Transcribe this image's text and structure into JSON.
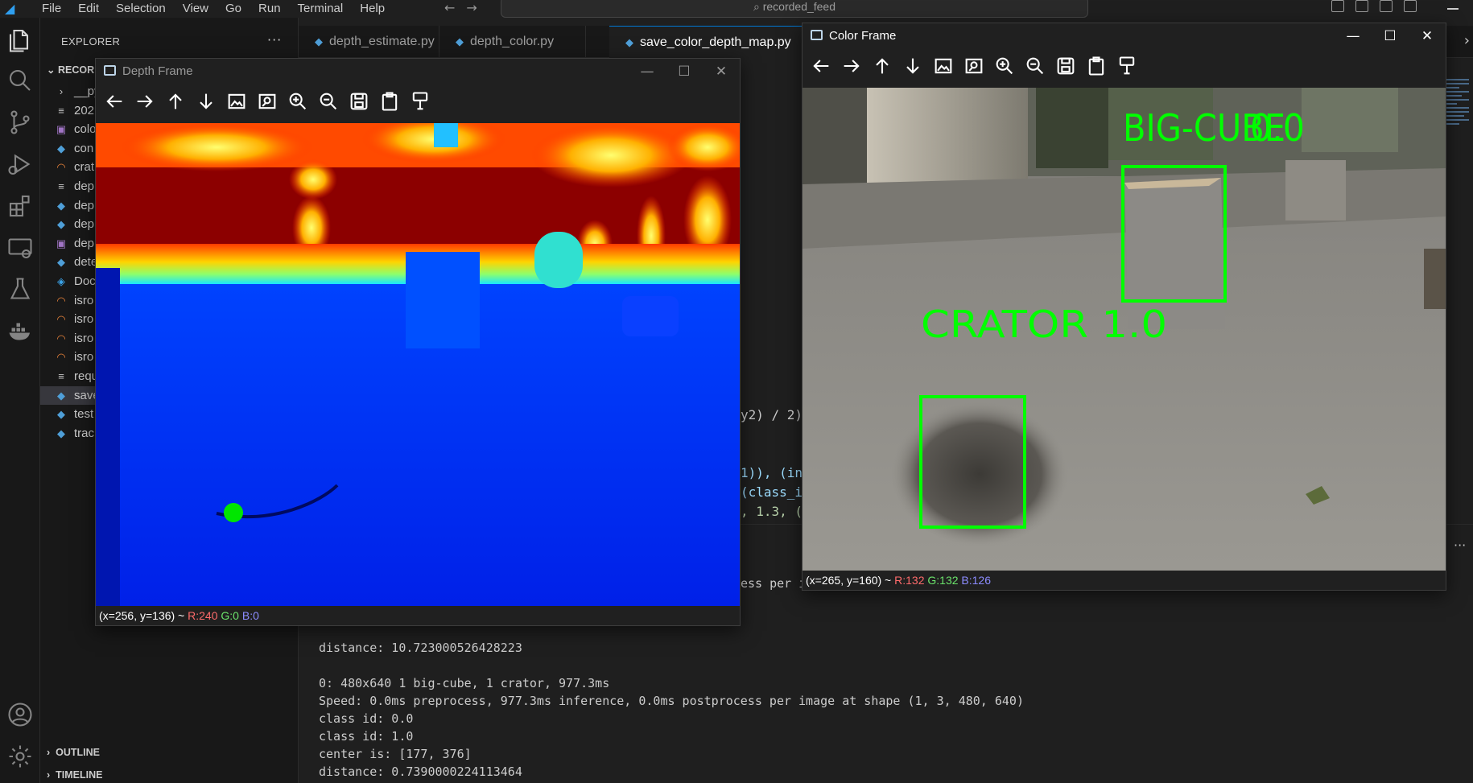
{
  "menu": [
    "File",
    "Edit",
    "Selection",
    "View",
    "Go",
    "Run",
    "Terminal",
    "Help"
  ],
  "search": {
    "text": "recorded_feed"
  },
  "sidebar": {
    "title": "EXPLORER",
    "root_label": "RECOR",
    "items": [
      {
        "icon": "chevron-right-icon",
        "glyph": "›",
        "kind": "ic-chev",
        "label": "__py"
      },
      {
        "icon": "list-icon",
        "glyph": "≡",
        "kind": "ic-list",
        "label": "202"
      },
      {
        "icon": "image-file-icon",
        "glyph": "▣",
        "kind": "ic-img",
        "label": "colo"
      },
      {
        "icon": "python-file-icon",
        "glyph": "◆",
        "kind": "ic-py",
        "label": "con"
      },
      {
        "icon": "rss-file-icon",
        "glyph": "◠",
        "kind": "ic-rss",
        "label": "crat"
      },
      {
        "icon": "list-icon",
        "glyph": "≡",
        "kind": "ic-list",
        "label": "dep"
      },
      {
        "icon": "python-file-icon",
        "glyph": "◆",
        "kind": "ic-py",
        "label": "dep"
      },
      {
        "icon": "python-file-icon",
        "glyph": "◆",
        "kind": "ic-py",
        "label": "dep"
      },
      {
        "icon": "image-file-icon",
        "glyph": "▣",
        "kind": "ic-img",
        "label": "dep"
      },
      {
        "icon": "python-file-icon",
        "glyph": "◆",
        "kind": "ic-py",
        "label": "dete"
      },
      {
        "icon": "docker-icon",
        "glyph": "◈",
        "kind": "ic-docker",
        "label": "Doc"
      },
      {
        "icon": "rss-file-icon",
        "glyph": "◠",
        "kind": "ic-rss",
        "label": "isro"
      },
      {
        "icon": "rss-file-icon",
        "glyph": "◠",
        "kind": "ic-rss",
        "label": "isro"
      },
      {
        "icon": "rss-file-icon",
        "glyph": "◠",
        "kind": "ic-rss",
        "label": "isro"
      },
      {
        "icon": "rss-file-icon",
        "glyph": "◠",
        "kind": "ic-rss",
        "label": "isro"
      },
      {
        "icon": "list-icon",
        "glyph": "≡",
        "kind": "ic-list",
        "label": "requ"
      },
      {
        "icon": "python-file-icon",
        "glyph": "◆",
        "kind": "ic-py",
        "label": "save"
      },
      {
        "icon": "python-file-icon",
        "glyph": "◆",
        "kind": "ic-py",
        "label": "test"
      },
      {
        "icon": "python-file-icon",
        "glyph": "◆",
        "kind": "ic-py",
        "label": "trac"
      }
    ],
    "outline": "OUTLINE",
    "timeline": "TIMELINE"
  },
  "tabs": [
    {
      "label": "depth_estimate.py",
      "active": false
    },
    {
      "label": "depth_color.py",
      "active": false
    },
    {
      "label": "save_color_depth_map.py",
      "active": true
    }
  ],
  "code_fragments": {
    "line1": "y2) / 2)",
    "line2": "1)), (in",
    "line3": "(class_i",
    "line4": ", 1.3, (",
    "term_frag": "ess per i"
  },
  "terminal_lines": [
    "distance: 10.723000526428223",
    "",
    "0: 480x640 1 big-cube, 1 crator, 977.3ms",
    "Speed: 0.0ms preprocess, 977.3ms inference, 0.0ms postprocess per image at shape (1, 3, 480, 640)",
    "class id: 0.0",
    "class id: 1.0",
    "center is: [177, 376]",
    "distance: 0.7390000224113464"
  ],
  "depth_window": {
    "title": "Depth Frame",
    "status_coords": "(x=256, y=136) ~",
    "status_r": "R:240",
    "status_g": "G:0",
    "status_b": "B:0"
  },
  "color_window": {
    "title": "Color Frame",
    "status_coords": "(x=265, y=160) ~",
    "status_r": "R:132",
    "status_g": "G:132",
    "status_b": "B:126",
    "label_cube": "BIG-CUBE",
    "label_cube_overlap": "0.0",
    "label_crator": "CRATOR  1.0",
    "box_color": "#00ff00"
  },
  "toolbar_tools": [
    "arrow-left-icon",
    "arrow-right-icon",
    "arrow-up-icon",
    "arrow-down-icon",
    "image-icon",
    "image-settings-icon",
    "zoom-in-icon",
    "zoom-out-icon",
    "save-icon",
    "clipboard-icon",
    "paint-brush-icon"
  ],
  "colors": {
    "accent": "#0078d4",
    "editor_bg": "#1f1f1f",
    "sidebar_bg": "#181818",
    "status_red": "#ff6b6b"
  }
}
